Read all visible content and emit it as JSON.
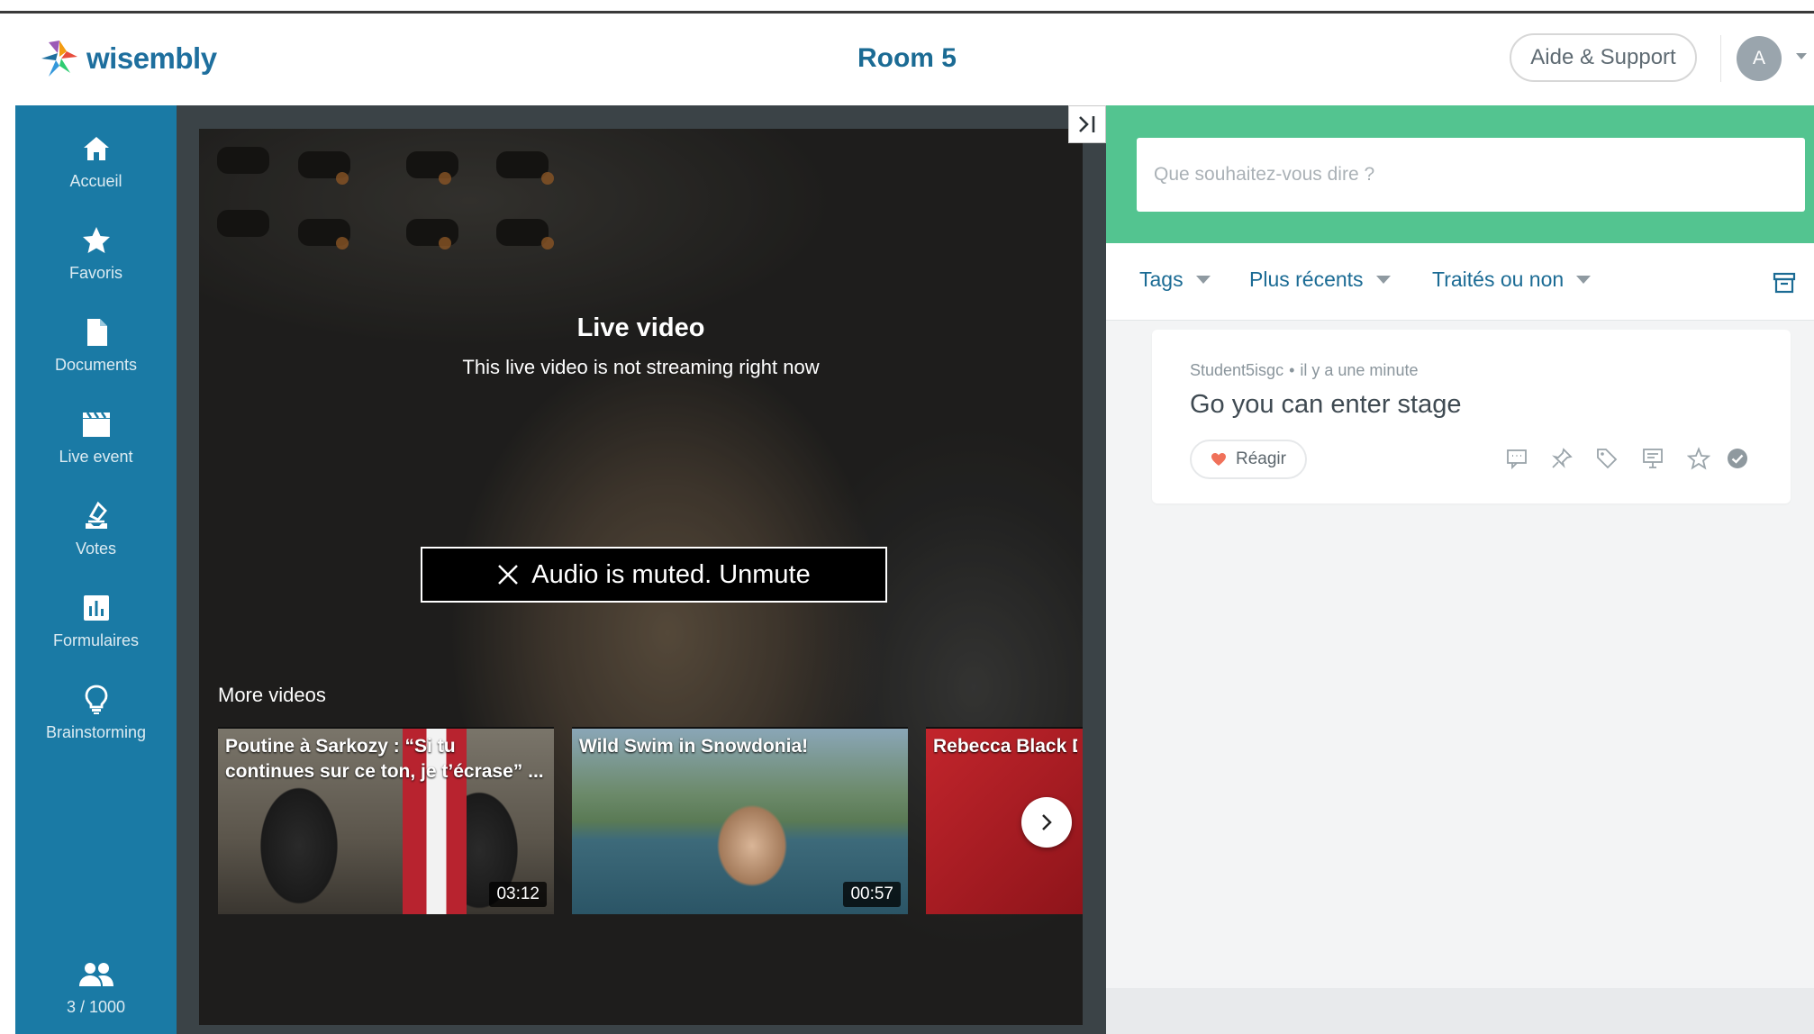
{
  "header": {
    "brand": "wisembly",
    "room_title": "Room 5",
    "support_label": "Aide & Support",
    "avatar_initial": "A"
  },
  "sidebar": {
    "items": [
      {
        "label": "Accueil",
        "icon": "home-icon"
      },
      {
        "label": "Favoris",
        "icon": "star-icon"
      },
      {
        "label": "Documents",
        "icon": "document-icon"
      },
      {
        "label": "Live event",
        "icon": "clapperboard-icon"
      },
      {
        "label": "Votes",
        "icon": "ballot-icon"
      },
      {
        "label": "Formulaires",
        "icon": "bar-chart-icon"
      },
      {
        "label": "Brainstorming",
        "icon": "lightbulb-icon"
      }
    ],
    "participants": {
      "label": "3 / 1000",
      "icon": "people-icon"
    }
  },
  "video": {
    "title": "Live video",
    "subtitle": "This live video is not streaming right now",
    "unmute_label": "Audio is muted. Unmute",
    "more_videos_label": "More videos",
    "thumbnails": [
      {
        "title": "Poutine à Sarkozy : “Si tu continues sur ce ton, je t’écrase” ...",
        "duration": "03:12"
      },
      {
        "title": "Wild Swim in Snowdonia!",
        "duration": "00:57"
      },
      {
        "title": "Rebecca Black D Her Favorite Acc",
        "duration": ""
      }
    ]
  },
  "panel": {
    "ask_placeholder": "Que souhaitez-vous dire ?",
    "filters": {
      "tags": "Tags",
      "sort": "Plus récents",
      "status": "Traités ou non"
    },
    "message": {
      "author": "Student5isgc",
      "time": "il y a une minute",
      "text": "Go you can enter stage",
      "react_label": "Réagir"
    }
  },
  "colors": {
    "sidebar": "#1a7aa5",
    "accent_green": "#53c490",
    "brand_blue": "#1b6b94"
  }
}
